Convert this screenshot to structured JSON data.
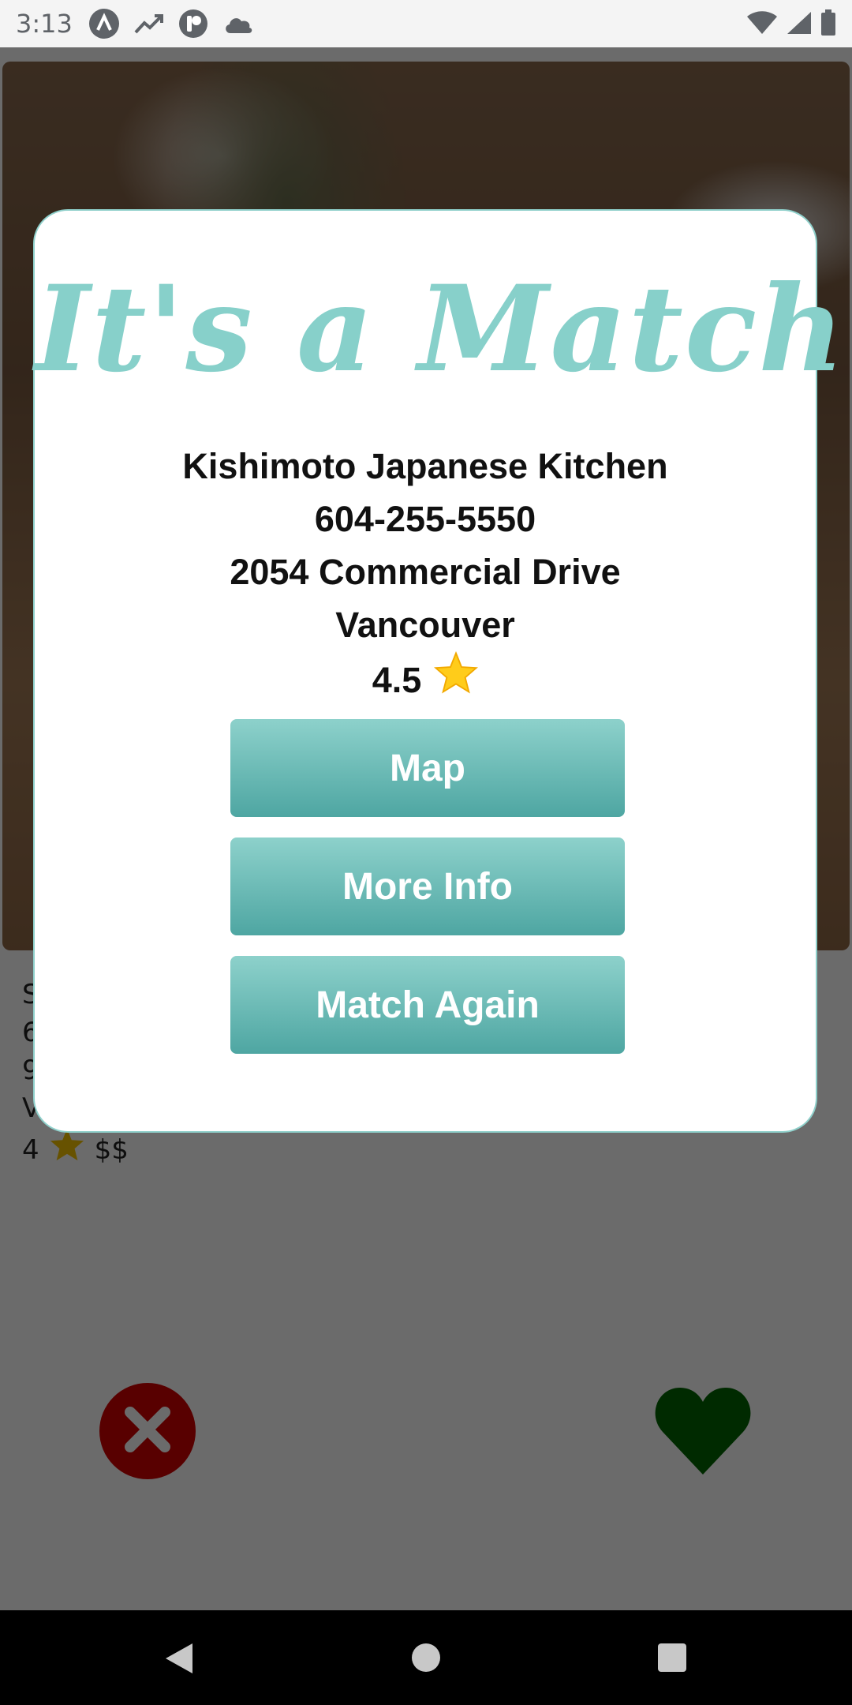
{
  "status_bar": {
    "time": "3:13",
    "left_icons": [
      "arch-app-icon",
      "trending-icon",
      "profile-app-icon",
      "cloud-icon"
    ],
    "right_icons": [
      "wifi-icon",
      "cell-signal-icon",
      "battery-icon"
    ]
  },
  "card": {
    "lines": [
      "S",
      "6",
      "9",
      "V"
    ],
    "rating": "4",
    "rating_icon": "star-icon",
    "price": "$$"
  },
  "match_modal": {
    "title": "It's a Match!",
    "restaurant_name": "Kishimoto Japanese Kitchen",
    "phone": "604-255-5550",
    "address": "2054 Commercial Drive",
    "city": "Vancouver",
    "rating": "4.5",
    "rating_icon": "star-icon",
    "buttons": {
      "map": "Map",
      "more_info": "More Info",
      "match_again": "Match Again"
    }
  },
  "actions": {
    "dislike_icon": "close-icon",
    "like_icon": "heart-icon"
  },
  "nav_bar": {
    "icons": [
      "back-icon",
      "home-icon",
      "recents-icon"
    ]
  },
  "colors": {
    "accent": "#87d0ca",
    "button_top": "#8dd1cb",
    "button_bottom": "#4ea6a2",
    "dislike": "#d10000",
    "like": "#006400"
  }
}
